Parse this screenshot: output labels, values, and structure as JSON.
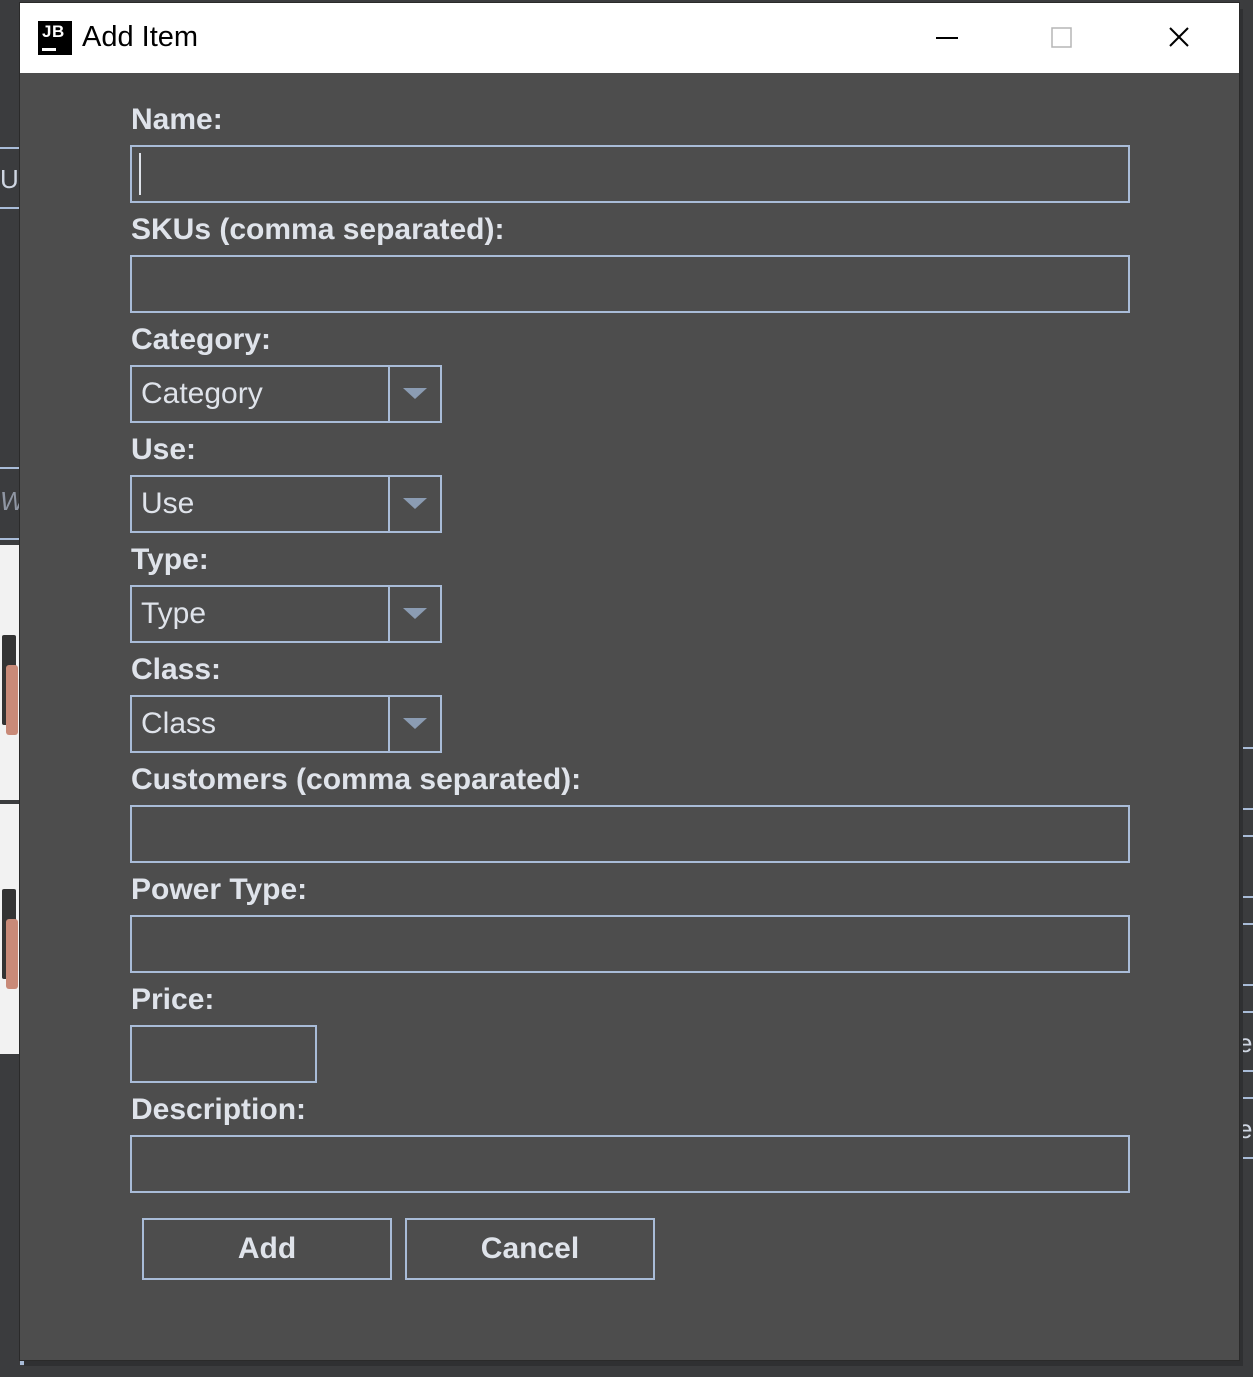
{
  "window": {
    "title": "Add Item",
    "app_icon_text": "JB",
    "controls": [
      "minimize-icon",
      "maximize-icon",
      "close-icon"
    ]
  },
  "form": {
    "name_label": "Name:",
    "name_value": "",
    "skus_label": "SKUs (comma separated):",
    "skus_value": "",
    "category_label": "Category:",
    "category_selected": "Category",
    "use_label": "Use:",
    "use_selected": "Use",
    "type_label": "Type:",
    "type_selected": "Type",
    "class_label": "Class:",
    "class_selected": "Class",
    "customers_label": "Customers (comma separated):",
    "customers_value": "",
    "power_type_label": "Power Type:",
    "power_type_value": "",
    "price_label": "Price:",
    "price_value": "",
    "description_label": "Description:",
    "description_value": ""
  },
  "buttons": {
    "add_label": "Add",
    "cancel_label": "Cancel"
  },
  "background": {
    "left_fragment_1": "Us",
    "left_fragment_2": "W",
    "right_fragment_1": "e",
    "right_fragment_2": "e"
  },
  "colors": {
    "dialog_bg": "#4d4d4d",
    "border": "#a9bcd8",
    "text": "#dfe3ea",
    "titlebar": "#ffffff"
  }
}
